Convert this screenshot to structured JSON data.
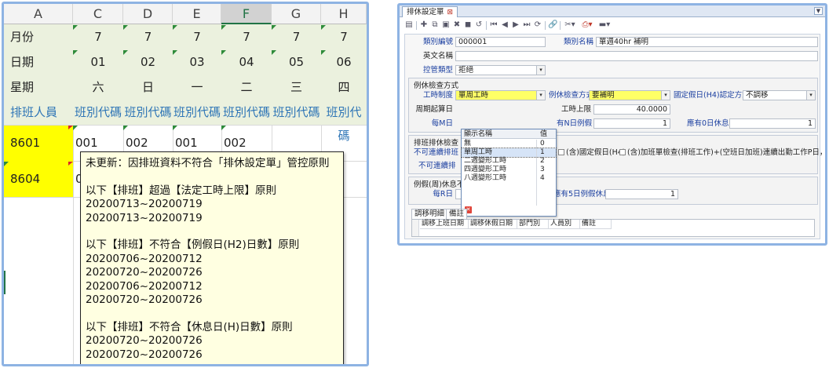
{
  "sheet": {
    "columns": [
      "A",
      "C",
      "D",
      "E",
      "F",
      "G",
      "H"
    ],
    "selected_column": "F",
    "rows": {
      "month": {
        "label": "月份",
        "values": [
          "7",
          "7",
          "7",
          "7",
          "7",
          "7"
        ]
      },
      "date": {
        "label": "日期",
        "values": [
          "01",
          "02",
          "03",
          "04",
          "05",
          "06"
        ]
      },
      "weekday": {
        "label": "星期",
        "values": [
          "六",
          "日",
          "一",
          "二",
          "三",
          "四"
        ]
      },
      "header": {
        "label": "排班人員",
        "values": [
          "班別代碼",
          "班別代碼",
          "班別代碼",
          "班別代碼",
          "班別代碼",
          "班別代碼"
        ]
      }
    },
    "data_rows": [
      {
        "id": "8601",
        "values": [
          "001",
          "002",
          "001",
          "002"
        ]
      },
      {
        "id": "8604",
        "values": [
          "00"
        ]
      }
    ],
    "comment": {
      "lines": [
        "未更新：因排班資料不符合「排休設定單」管控原則",
        "",
        "以下【排班】超過【法定工時上限】原則",
        "20200713~20200719",
        "20200713~20200719",
        "",
        "以下【排班】不符合【例假日(H2)日數】原則",
        "20200706~20200712",
        "20200720~20200726",
        "20200706~20200712",
        "20200720~20200726",
        "",
        "以下【排班】不符合【休息日(H)日數】原則",
        "20200720~20200726",
        "20200720~20200726"
      ]
    }
  },
  "form": {
    "tab_title": "排休設定單",
    "fields": {
      "category_no_label": "類別編號",
      "category_no": "000001",
      "category_name_label": "類別名稱",
      "category_name": "單週40hr 補明",
      "en_name_label": "英文名稱",
      "en_name": "",
      "control_type_label": "控管類型",
      "control_type": "拒絕"
    },
    "rest_check": {
      "title": "例休檢查方式",
      "work_system_label": "工時制度",
      "work_system": "單周工時",
      "rest_check_label": "例休檢查方式",
      "rest_check": "要補明",
      "fixed_holiday_label": "國定假日(H4)認定方式",
      "fixed_holiday": "不調移",
      "cycle_start_label": "周期起算日",
      "hours_limit_label": "工時上限",
      "hours_limit": "40.0000",
      "every_m_label": "每M日",
      "n_day_label": "有N日例假",
      "n_day": "1",
      "rest0_label": "應有0日休息",
      "rest0": "1"
    },
    "dropdown": {
      "col_name": "顯示名稱",
      "col_value": "值",
      "options": [
        {
          "name": "無",
          "value": "0"
        },
        {
          "name": "單周工時",
          "value": "1"
        },
        {
          "name": "二週變形工時",
          "value": "2"
        },
        {
          "name": "四週變形工時",
          "value": "3"
        },
        {
          "name": "八週變形工時",
          "value": "4"
        }
      ],
      "selected_index": 1
    },
    "shift_check": {
      "title": "排班排休檢查",
      "no_continuous_1": "不可連續排班",
      "no_continuous_2": "不可連續排",
      "opt_h4": "(含)國定假日(H4)",
      "opt_overtime": "(含)加班單檢查(排班工作)+(空班日加班)連續出勤工作P日，次日需休"
    },
    "leave": {
      "title": "例假(周)休息不",
      "every_r_label": "每R日",
      "every_r": "7",
      "min5_label": "至少應有5日例假休息",
      "min5": "1"
    },
    "subtabs": [
      "調移明細",
      "備註"
    ],
    "grid_headers": [
      "調移上班日期",
      "調移休假日期",
      "部門別",
      "人員別",
      "備註"
    ]
  }
}
